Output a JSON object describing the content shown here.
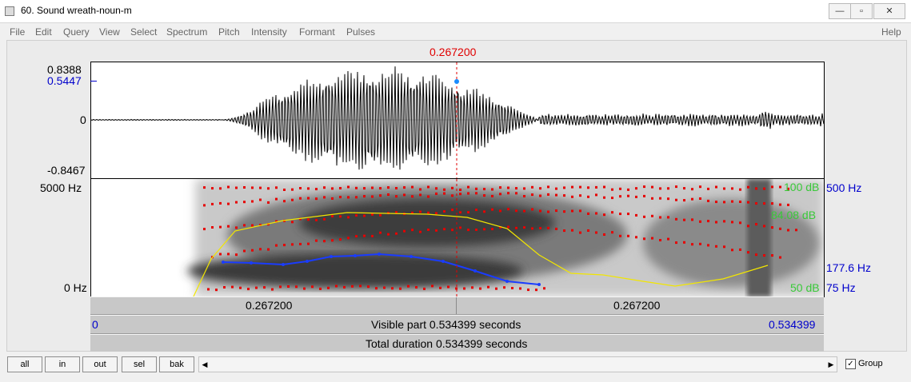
{
  "window": {
    "title": "60. Sound wreath-noun-m",
    "controls": {
      "minimize": "—",
      "maximize": "▫",
      "close": "✕"
    }
  },
  "menu": [
    "File",
    "Edit",
    "Query",
    "View",
    "Select",
    "Spectrum",
    "Pitch",
    "Intensity",
    "Formant",
    "Pulses"
  ],
  "menu_help": "Help",
  "cursor": {
    "time_label": "0.267200",
    "time_s": 0.2672
  },
  "waveform": {
    "max_label": "0.8388",
    "cursor_value_label": "0.5447",
    "zero_label": "0",
    "min_label": "-0.8467",
    "max": 0.8388,
    "min": -0.8467,
    "cursor_value": 0.5447
  },
  "spectrogram": {
    "freq_top_label": "5000 Hz",
    "freq_bottom_label": "0 Hz",
    "intensity_top_label": "100 dB",
    "intensity_value_label": "84.08 dB",
    "intensity_bottom_label": "50 dB",
    "pitch_top_label": "500 Hz",
    "pitch_value_label": "177.6 Hz",
    "pitch_bottom_label": "75 Hz"
  },
  "time_axis": {
    "left_segment_label": "0.267200",
    "right_segment_label": "0.267200",
    "visible_start_label": "0",
    "visible_text": "Visible part 0.534399 seconds",
    "visible_end_label": "0.534399",
    "total_text": "Total duration 0.534399 seconds"
  },
  "zoom_buttons": [
    "all",
    "in",
    "out",
    "sel",
    "bak"
  ],
  "scroll": {
    "left_arrow": "◀",
    "right_arrow": "▶"
  },
  "group": {
    "label": "Group",
    "checked": true,
    "check_mark": "✓"
  },
  "colors": {
    "cursor": "#e00000",
    "pitch_line": "#1a3cff",
    "intensity_line": "#f2e600",
    "formant_dots": "#e60000",
    "axis_blue": "#0000cc",
    "axis_green": "#39c939"
  }
}
